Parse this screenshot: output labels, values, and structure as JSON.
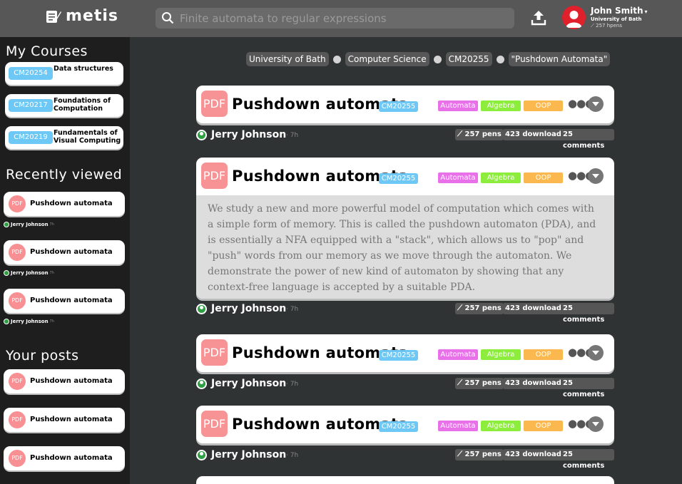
{
  "app": {
    "name": "metis"
  },
  "search": {
    "placeholder": "Finite automata to regular expressions"
  },
  "user": {
    "name": "John Smith",
    "university": "University of Bath",
    "pens": "257 hpens"
  },
  "sidebar": {
    "courses_title": "My Courses",
    "courses": [
      {
        "code": "CM20254",
        "name": "Data structures"
      },
      {
        "code": "CM20217",
        "name": "Foundations of Computation"
      },
      {
        "code": "CM20219",
        "name": "Fundamentals of Visual Computing"
      }
    ],
    "recent_title": "Recently viewed",
    "recent": [
      {
        "pdf": "PDF",
        "title": "Pushdown automata",
        "author": "Jerry Johnson",
        "time": "7h"
      },
      {
        "pdf": "PDF",
        "title": "Pushdown automata",
        "author": "Jerry Johnson",
        "time": "7h"
      },
      {
        "pdf": "PDF",
        "title": "Pushdown automata",
        "author": "Jerry Johnson",
        "time": "7h"
      }
    ],
    "posts_title": "Your posts",
    "posts": [
      {
        "pdf": "PDF",
        "title": "Pushdown automata"
      },
      {
        "pdf": "PDF",
        "title": "Pushdown automata"
      },
      {
        "pdf": "PDF",
        "title": "Pushdown automata"
      }
    ]
  },
  "breadcrumb": [
    "University of Bath",
    "Computer Science",
    "CM20255",
    "\"Pushdown Automata\""
  ],
  "posts": [
    {
      "pdf": "PDF",
      "title": "Pushdown automata",
      "course": "CM20255",
      "tags": [
        "Automata",
        "Algebra",
        "OOP"
      ],
      "author": "Jerry Johnson",
      "time": "· 7h",
      "pens": "257 pens",
      "downloads": "423 downloads",
      "comments": "25 comments"
    },
    {
      "pdf": "PDF",
      "title": "Pushdown automata",
      "course": "CM20255",
      "tags": [
        "Automata",
        "Algebra",
        "OOP"
      ],
      "description": "We study a new and more powerful model of computation which comes with a simple form of memory. This is called the pushdown automaton (PDA), and is essentially a NFA equipped with a \"stack\", which allows us to \"pop\" and \"push\" words from our memory as we move through the automaton. We demonstrate the power of new kind of automaton by showing that any context-free language is accepted by a suitable PDA.",
      "author": "Jerry Johnson",
      "time": "· 7h",
      "pens": "257 pens",
      "downloads": "423 downloads",
      "comments": "25 comments"
    },
    {
      "pdf": "PDF",
      "title": "Pushdown automata",
      "course": "CM20255",
      "tags": [
        "Automata",
        "Algebra",
        "OOP"
      ],
      "author": "Jerry Johnson",
      "time": "· 7h",
      "pens": "257 pens",
      "downloads": "423 downloads",
      "comments": "25 comments"
    },
    {
      "pdf": "PDF",
      "title": "Pushdown automata",
      "course": "CM20255",
      "tags": [
        "Automata",
        "Algebra",
        "OOP"
      ],
      "author": "Jerry Johnson",
      "time": "· 7h",
      "pens": "257 pens",
      "downloads": "423 downloads",
      "comments": "25 comments"
    }
  ],
  "colors": {
    "topbar": "#575757",
    "sidebar": "#1e1e1e",
    "main": "#2f3333",
    "course_code": "#6ec8f6",
    "pdf": "#f79394",
    "tag_automata": "#e871ea",
    "tag_algebra": "#8ded3c",
    "tag_oop": "#fbb84f",
    "avatar": "#e0202a",
    "author_dot": "#2ea043"
  }
}
